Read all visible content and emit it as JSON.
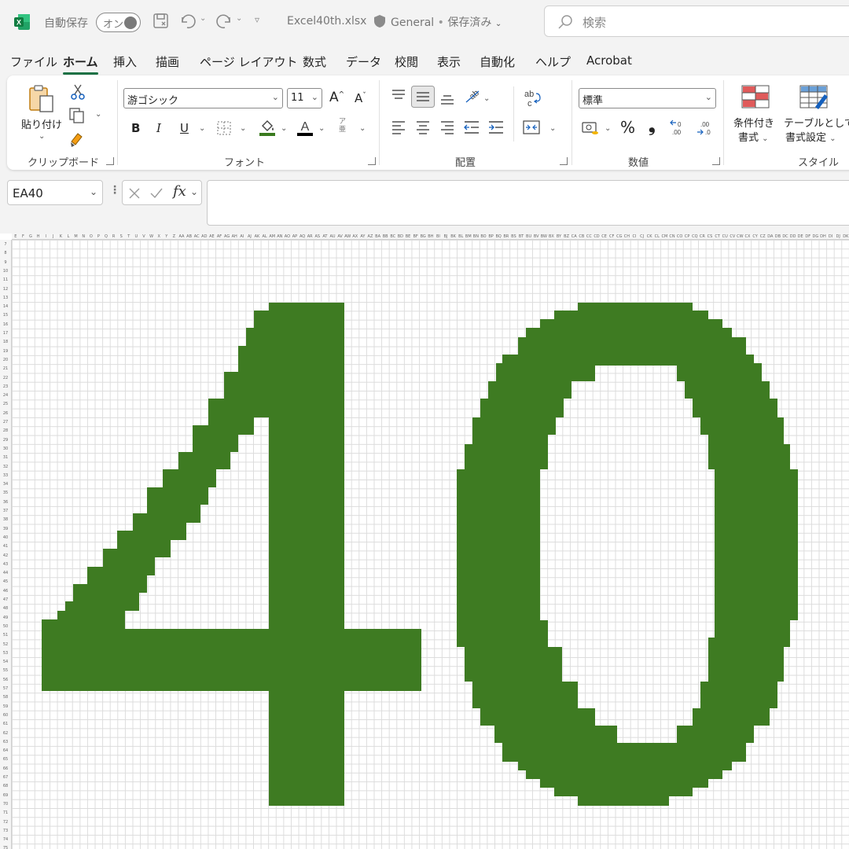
{
  "titlebar": {
    "autosave_label": "自動保存",
    "autosave_state": "オン",
    "filename": "Excel40th.xlsx",
    "sensitivity": "General",
    "save_status": "保存済み",
    "search_placeholder": "検索"
  },
  "menu_tabs": [
    "ファイル",
    "ホーム",
    "挿入",
    "描画",
    "ページ レイアウト",
    "数式",
    "データ",
    "校閲",
    "表示",
    "自動化",
    "ヘルプ",
    "Acrobat"
  ],
  "active_tab": "ホーム",
  "ribbon": {
    "clipboard": {
      "label": "クリップボード",
      "paste": "貼り付け"
    },
    "font": {
      "label": "フォント",
      "font_name": "游ゴシック",
      "font_size": "11",
      "bold": "B",
      "italic": "I",
      "underline": "U",
      "fill_color": "#3a7a1f",
      "font_color": "#000000"
    },
    "alignment": {
      "label": "配置"
    },
    "number": {
      "label": "数値",
      "format": "標準",
      "percent": "%",
      "comma": "❟"
    },
    "styles": {
      "label": "スタイル",
      "conditional": "条件付き",
      "conditional2": "書式",
      "table": "テーブルとして",
      "table2": "書式設定"
    }
  },
  "formula_bar": {
    "name_box": "EA40",
    "formula": ""
  },
  "sheet": {
    "first_row": 7,
    "last_row": 75,
    "fill_color": "#3e7b22",
    "displayed_text": "40"
  },
  "colors": {
    "accent": "#1e7145",
    "cell_fill": "#3e7b22"
  }
}
